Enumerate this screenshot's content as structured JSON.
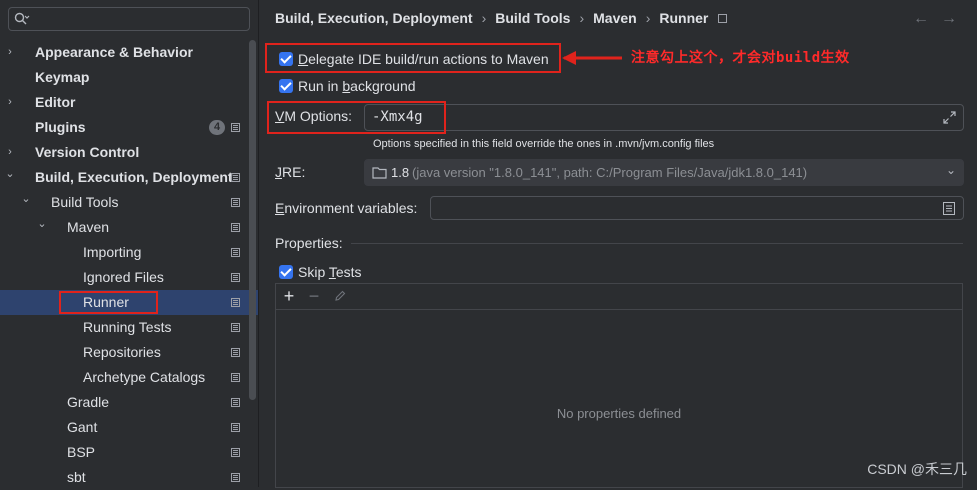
{
  "sidebar": {
    "search": {
      "placeholder": "",
      "value": ""
    },
    "items": [
      {
        "label": "Appearance & Behavior",
        "bold": true,
        "expandable": true,
        "expanded": false
      },
      {
        "label": "Keymap",
        "bold": true,
        "expandable": false
      },
      {
        "label": "Editor",
        "bold": true,
        "expandable": true,
        "expanded": false
      },
      {
        "label": "Plugins",
        "bold": true,
        "expandable": false,
        "badge": "4"
      },
      {
        "label": "Version Control",
        "bold": true,
        "expandable": true,
        "expanded": false
      },
      {
        "label": "Build, Execution, Deployment",
        "bold": true,
        "expandable": true,
        "expanded": true
      },
      {
        "label": "Build Tools",
        "expandable": true,
        "expanded": true
      },
      {
        "label": "Maven",
        "expandable": true,
        "expanded": true
      },
      {
        "label": "Importing"
      },
      {
        "label": "Ignored Files"
      },
      {
        "label": "Runner",
        "selected": true
      },
      {
        "label": "Running Tests"
      },
      {
        "label": "Repositories"
      },
      {
        "label": "Archetype Catalogs"
      },
      {
        "label": "Gradle"
      },
      {
        "label": "Gant"
      },
      {
        "label": "BSP"
      },
      {
        "label": "sbt"
      }
    ]
  },
  "breadcrumb": [
    "Build, Execution, Deployment",
    "Build Tools",
    "Maven",
    "Runner"
  ],
  "form": {
    "delegate_checkbox": {
      "label": "Delegate IDE build/run actions to Maven",
      "checked": true
    },
    "background_checkbox": {
      "label_pre": "Run in ",
      "label_mnemonic": "b",
      "label_post": "ackground",
      "checked": true
    },
    "vm_options": {
      "label_mnemonic": "V",
      "label_rest": "M Options:",
      "value": "-Xmx4g"
    },
    "vm_hint": "Options specified in this field override the ones in .mvn/jvm.config files",
    "jre": {
      "label_mnemonic": "J",
      "label_rest": "RE:",
      "version": "1.8",
      "detail": "(java version \"1.8.0_141\", path: C:/Program Files/Java/jdk1.8.0_141)"
    },
    "env_vars": {
      "label_mnemonic": "E",
      "label_rest": "nvironment variables:",
      "value": ""
    },
    "properties_label": "Properties:",
    "skip_tests": {
      "label_pre": "Skip ",
      "label_mnemonic": "T",
      "label_post": "ests",
      "checked": true
    },
    "properties_empty": "No properties defined"
  },
  "annotation": {
    "text": "注意勾上这个，才会对build生效",
    "color": "#ff2a2a"
  },
  "watermark": "CSDN @禾三几",
  "colors": {
    "background": "#2b2d30",
    "selection": "#2e436e",
    "accent": "#3574f0",
    "annotation_red": "#e0231c"
  }
}
